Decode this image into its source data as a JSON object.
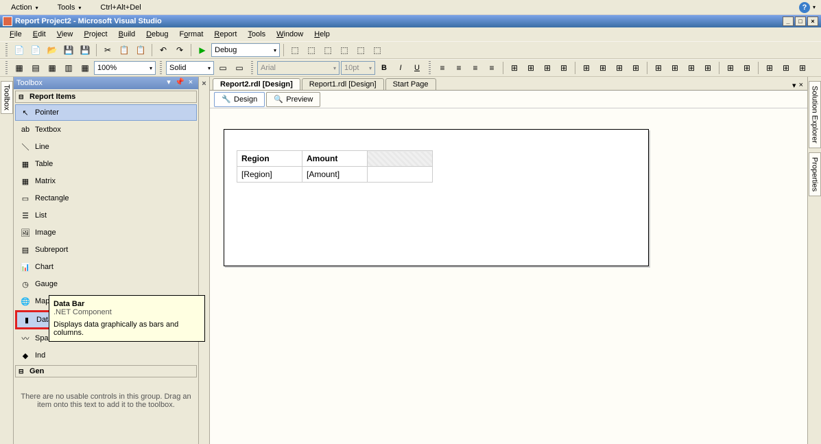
{
  "vm_menu": {
    "action": "Action",
    "tools": "Tools",
    "cad": "Ctrl+Alt+Del"
  },
  "title": "Report Project2 - Microsoft Visual Studio",
  "main_menu": [
    "File",
    "Edit",
    "View",
    "Project",
    "Build",
    "Debug",
    "Format",
    "Report",
    "Tools",
    "Window",
    "Help"
  ],
  "toolbar1": {
    "config": "Debug"
  },
  "toolbar2": {
    "zoom": "100%",
    "linestyle": "Solid",
    "font": "Arial",
    "fontsize": "10pt"
  },
  "left_tab": "Toolbox",
  "toolbox": {
    "title": "Toolbox",
    "group1": "Report Items",
    "items": [
      "Pointer",
      "Textbox",
      "Line",
      "Table",
      "Matrix",
      "Rectangle",
      "List",
      "Image",
      "Subreport",
      "Chart",
      "Gauge",
      "Map",
      "Data Bar",
      "Sparkline",
      "Indicator"
    ],
    "item_short": "Ind",
    "group2": "General",
    "group2_short": "Gen",
    "empty_msg": "There are no usable controls in this group. Drag an item onto this text to add it to the toolbox."
  },
  "doc_tabs": [
    "Report2.rdl [Design]",
    "Report1.rdl [Design]",
    "Start Page"
  ],
  "view_tabs": {
    "design": "Design",
    "preview": "Preview"
  },
  "report": {
    "headers": [
      "Region",
      "Amount",
      ""
    ],
    "row": [
      "[Region]",
      "[Amount]",
      ""
    ]
  },
  "right_tabs": [
    "Solution Explorer",
    "Properties"
  ],
  "tooltip": {
    "title": "Data Bar",
    "sub": ".NET Component",
    "desc": "Displays data graphically as bars and columns."
  }
}
